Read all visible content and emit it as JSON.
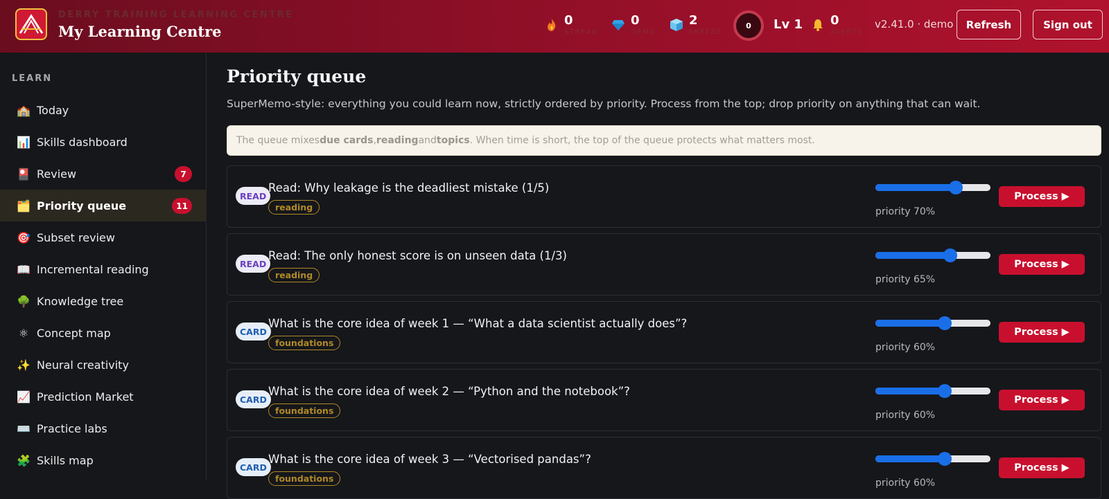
{
  "header": {
    "brand_sub": "DERRY TRAINING LEARNING CENTRE",
    "brand_title": "My Learning Centre",
    "stats": [
      {
        "icon": "flame-icon",
        "value": "0",
        "label": "STREAK"
      },
      {
        "icon": "gem-icon",
        "value": "0",
        "label": "GEMS"
      },
      {
        "icon": "ice-cube-icon",
        "value": "2",
        "label": "FREEZE"
      }
    ],
    "ring_value": "0",
    "level": "Lv 1",
    "alerts": {
      "icon": "bell-icon",
      "value": "0",
      "label": "ALERTS"
    },
    "version": "v2.41.0 · demo",
    "refresh_label": "Refresh",
    "signout_label": "Sign out"
  },
  "sidebar": {
    "heading": "LEARN",
    "items": [
      {
        "icon": "🏫",
        "label": "Today"
      },
      {
        "icon": "📊",
        "label": "Skills dashboard"
      },
      {
        "icon": "🎴",
        "label": "Review",
        "badge": "7"
      },
      {
        "icon": "🗂️",
        "label": "Priority queue",
        "badge": "11",
        "active": true
      },
      {
        "icon": "🎯",
        "label": "Subset review"
      },
      {
        "icon": "📖",
        "label": "Incremental reading"
      },
      {
        "icon": "🌳",
        "label": "Knowledge tree"
      },
      {
        "icon": "⚛",
        "label": "Concept map"
      },
      {
        "icon": "✨",
        "label": "Neural creativity"
      },
      {
        "icon": "📈",
        "label": "Prediction Market"
      },
      {
        "icon": "⌨️",
        "label": "Practice labs"
      },
      {
        "icon": "🧩",
        "label": "Skills map"
      }
    ]
  },
  "main": {
    "title": "Priority queue",
    "description": "SuperMemo-style: everything you could learn now, strictly ordered by priority. Process from the top; drop priority on anything that can wait.",
    "note": {
      "p1": "The queue mixes ",
      "b1": "due cards",
      "p2": ", ",
      "b2": "reading",
      "p3": " and ",
      "b3": "topics",
      "p4": ". When time is short, the top of the queue protects what matters most."
    },
    "process_label": "Process ▶",
    "rows": [
      {
        "kind": "READ",
        "title": "Read: Why leakage is the deadliest mistake (1/5)",
        "tag": "reading",
        "priority": 70,
        "priority_label": "priority 70%"
      },
      {
        "kind": "READ",
        "title": "Read: The only honest score is on unseen data (1/3)",
        "tag": "reading",
        "priority": 65,
        "priority_label": "priority 65%"
      },
      {
        "kind": "CARD",
        "title": "What is the core idea of week 1 — “What a data scientist actually does”?",
        "tag": "foundations",
        "priority": 60,
        "priority_label": "priority 60%"
      },
      {
        "kind": "CARD",
        "title": "What is the core idea of week 2 — “Python and the notebook”?",
        "tag": "foundations",
        "priority": 60,
        "priority_label": "priority 60%"
      },
      {
        "kind": "CARD",
        "title": "What is the core idea of week 3 — “Vectorised pandas”?",
        "tag": "foundations",
        "priority": 60,
        "priority_label": "priority 60%"
      }
    ]
  }
}
